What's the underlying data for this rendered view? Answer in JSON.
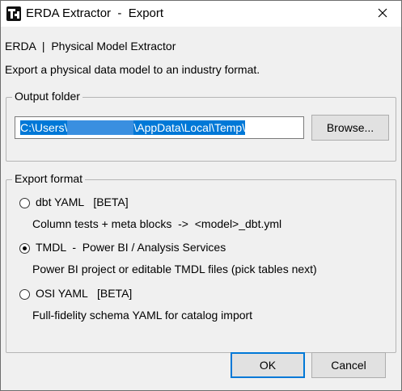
{
  "window": {
    "title": "ERDA Extractor  -  Export",
    "close_glyph": "✕"
  },
  "header": {
    "breadcrumb": "ERDA  |  Physical Model Extractor",
    "description": "Export a physical data model to an industry format."
  },
  "output_folder": {
    "legend": "Output folder",
    "path_prefix": "C:\\Users\\",
    "path_suffix": "\\AppData\\Local\\Temp\\",
    "browse_label": "Browse..."
  },
  "export_format": {
    "legend": "Export format",
    "options": [
      {
        "label": "dbt YAML   [BETA]",
        "description": "Column tests + meta blocks  ->  <model>_dbt.yml",
        "selected": false
      },
      {
        "label": "TMDL  -  Power BI / Analysis Services",
        "description": "Power BI project or editable TMDL files (pick tables next)",
        "selected": true
      },
      {
        "label": "OSI YAML   [BETA]",
        "description": "Full-fidelity schema YAML for catalog import",
        "selected": false
      }
    ]
  },
  "footer": {
    "ok_label": "OK",
    "cancel_label": "Cancel"
  }
}
